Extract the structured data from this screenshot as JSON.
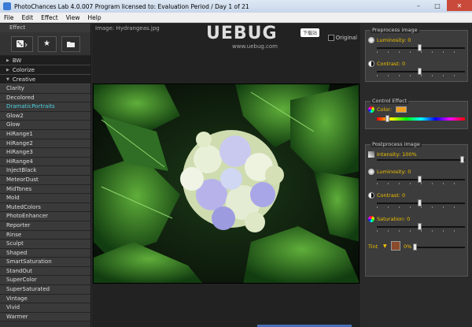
{
  "window": {
    "title": "PhotoChances Lab 4.0.007   Program licensed to: Evaluation Period / Day 1 of 21"
  },
  "menu": [
    "File",
    "Edit",
    "Effect",
    "View",
    "Help"
  ],
  "left": {
    "caption": "Effect",
    "categories": [
      "BW",
      "Colorize",
      "Creative"
    ],
    "effects": [
      "Clarity",
      "Decolored",
      "DramaticPortraits",
      "Glow2",
      "Glow",
      "HiRange1",
      "HiRange2",
      "HiRange3",
      "HiRange4",
      "InjectBlack",
      "MeteorDust",
      "MidTones",
      "Mold",
      "MutedColors",
      "PhotoEnhancer",
      "Reporter",
      "Rinse",
      "Sculpt",
      "Shaped",
      "SmartSaturation",
      "StandOut",
      "SuperColor",
      "SuperSaturated",
      "Vintage",
      "Vivid",
      "Warmer"
    ],
    "selected_index": 2
  },
  "center": {
    "caption": "Image: Hydrangeas.jpg",
    "original_label": "Original",
    "watermark": "UEBUG",
    "watermark_sub": "www.uebug.com",
    "watermark_badge": "下载站"
  },
  "right": {
    "preprocess": {
      "title": "Preprocess image",
      "luminosity": {
        "label": "Luminosity: 0",
        "value": 0
      },
      "contrast": {
        "label": "Contrast: 0",
        "value": 0
      }
    },
    "control": {
      "title": "Control Effect",
      "color_label": "Color:",
      "color_hex": "#f0a020",
      "hue_position": 0.1
    },
    "postprocess": {
      "title": "Postprocess image",
      "intensity": {
        "label": "Intensity: 100%",
        "value": 100
      },
      "luminosity": {
        "label": "Luminosity: 0",
        "value": 0
      },
      "contrast": {
        "label": "Contrast: 0",
        "value": 0
      },
      "saturation": {
        "label": "Saturation: 0",
        "value": 0
      },
      "tint": {
        "label": "Tint",
        "color_hex": "#8b4a2b",
        "value": "0%"
      }
    }
  }
}
